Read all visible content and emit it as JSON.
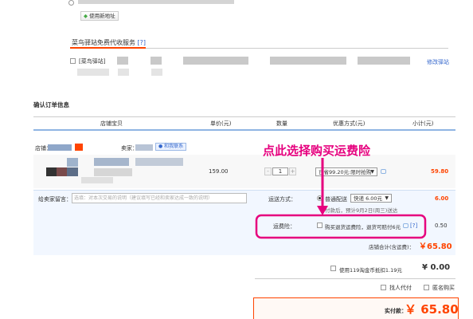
{
  "address": {
    "new_address_button": "使用新地址"
  },
  "cainiao": {
    "section_title": "菜鸟驿站免费代收服务",
    "help": "[?]",
    "option_label": "[菜鸟驿站]",
    "modify_link": "修改驿站"
  },
  "order": {
    "section_title": "确认订单信息",
    "headers": {
      "shop": "店铺宝贝",
      "price": "单价(元)",
      "qty": "数量",
      "discount": "优惠方式(元)",
      "subtotal": "小计(元)"
    },
    "shop_label": "店铺：",
    "seller_label": "卖家：",
    "contact_label": "和我联系",
    "item": {
      "price": "159.00",
      "qty": "1",
      "discount_select": "已省99.20元:限时抢购",
      "subtotal": "59.80"
    },
    "message_label": "给卖家留言：",
    "message_placeholder": "选填：对本次交易的说明（建议填写已经和卖家达成一致的说明）",
    "shipping": {
      "label": "运送方式：",
      "option": "普通配送",
      "select": "快递 6.00元",
      "note": "付款后，预计9月2日(周三)送达",
      "cost": "6.00"
    },
    "insurance": {
      "label": "运费险：",
      "option": "购买退货运费险，退货可赔付6元",
      "help": "[?]",
      "cost": "0.50"
    },
    "shop_total_label": "店铺合计(含运费)：",
    "shop_total": "￥65.80",
    "coupon_label": "使用119淘金币抵扣1.19元",
    "coupon_value": "¥ 0.00",
    "proxy_pay": "找人代付",
    "anonymous": "匿名购买",
    "paid_label": "实付款：",
    "paid_value": "￥ 65.80"
  },
  "annotation": {
    "text": "点此选择购买运费险"
  },
  "colors": {
    "accent": "#ff4400",
    "annotation": "#e6007e",
    "link": "#3366cc"
  }
}
